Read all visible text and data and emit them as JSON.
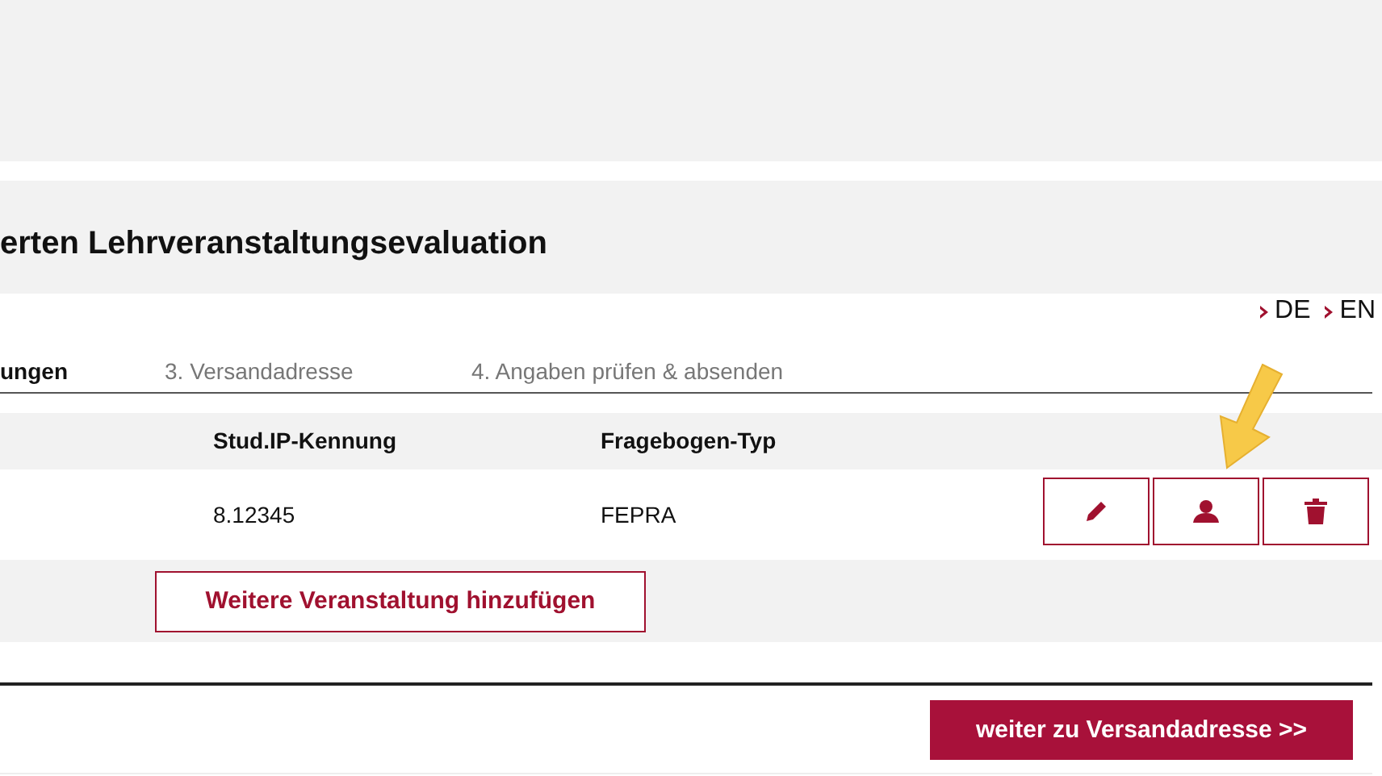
{
  "page_title": "erten Lehrveranstaltungsevaluation",
  "languages": [
    {
      "label": "DE"
    },
    {
      "label": "EN"
    }
  ],
  "steps": [
    {
      "label": "ungen",
      "selected": true
    },
    {
      "label": "3. Versandadresse",
      "selected": false
    },
    {
      "label": "4. Angaben prüfen & absenden",
      "selected": false
    }
  ],
  "table": {
    "columns": [
      "Stud.IP-Kennung",
      "Fragebogen-Typ"
    ],
    "rows": [
      {
        "cells": [
          "8.12345",
          "FEPRA"
        ]
      }
    ]
  },
  "add_button": "Weitere Veranstaltung hinzufügen",
  "next_button": "weiter zu Versandadresse >>"
}
